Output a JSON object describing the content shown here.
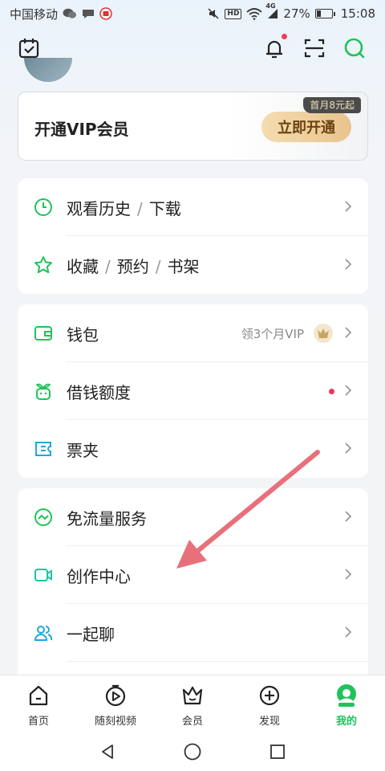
{
  "status_bar": {
    "carrier": "中国移动",
    "network": "4G",
    "battery": "27%",
    "battery_level": 0.27,
    "time": "15:08",
    "hd_label": "HD"
  },
  "top_bar": {
    "icons": [
      "calendar-check-icon",
      "bell-icon",
      "scan-icon",
      "search-icon"
    ]
  },
  "vip": {
    "title": "开通VIP会员",
    "button": "立即开通",
    "tag": "首月8元起"
  },
  "cards": {
    "group1": {
      "history": {
        "label": "观看历史",
        "label2": "下载",
        "slash": "/"
      },
      "favorites": {
        "label": "收藏",
        "label2": "预约",
        "label3": "书架",
        "slash": "/"
      }
    },
    "group2": {
      "wallet": {
        "label": "钱包",
        "hint": "领3个月VIP"
      },
      "credit": {
        "label": "借钱额度"
      },
      "tickets": {
        "label": "票夹"
      }
    },
    "group3": {
      "data_free": {
        "label": "免流量服务"
      },
      "creator": {
        "label": "创作中心"
      },
      "chat": {
        "label": "一起聊"
      }
    }
  },
  "colors": {
    "accent": "#1fc35a",
    "vip_button": "#e8c48d",
    "arrow": "#e8707a",
    "badge_dot": "#ec3560"
  },
  "bottom_nav": {
    "items": [
      {
        "label": "首页",
        "icon": "home-icon"
      },
      {
        "label": "随刻视频",
        "icon": "play-circle-icon"
      },
      {
        "label": "会员",
        "icon": "crown-icon"
      },
      {
        "label": "发现",
        "icon": "plus-circle-icon"
      },
      {
        "label": "我的",
        "icon": "profile-icon",
        "active": true
      }
    ]
  }
}
